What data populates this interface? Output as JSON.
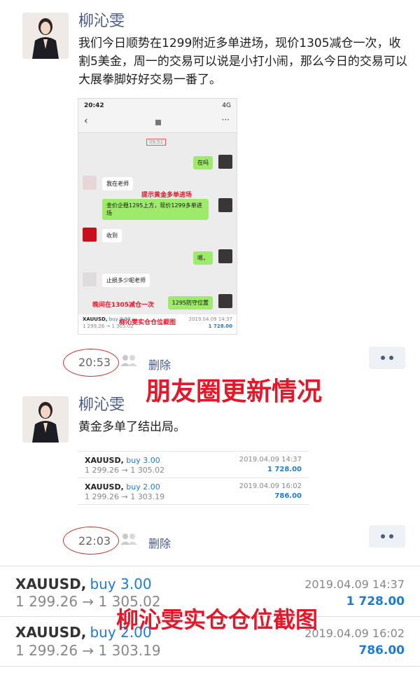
{
  "post1": {
    "author": "柳沁雯",
    "text": "我们今日顺势在1299附近多单进场，现价1305减仓一次，收割5美金，周一的交易可以说是小打小闹，那么今日的交易可以大展拳脚好好交易一番了。",
    "time": "20:53",
    "delete_label": "删除"
  },
  "chat_screenshot": {
    "status_time": "20:42",
    "network": "4G",
    "msg_time": "09:51",
    "messages": [
      {
        "side": "right",
        "text": "在吗"
      },
      {
        "side": "left",
        "text": "我在老师"
      },
      {
        "side": "right",
        "text": "金价企稳1295上方，现价1299多单进场"
      },
      {
        "side": "left",
        "text": "收到"
      },
      {
        "side": "right",
        "text": "嗯，"
      },
      {
        "side": "left",
        "text": "止损多少呢老师"
      },
      {
        "side": "right",
        "text": "1295防守位置"
      }
    ],
    "annotation_top": "提示黄金多单进场",
    "annotation_bottom": "晚间在1305减仓一次",
    "trade": {
      "symbol": "XAUUSD,",
      "side": "buy 3.00",
      "prices": "1 299.26 → 1 305.02",
      "date": "2019.04.09 14:37",
      "profit": "1 728.00"
    },
    "caption": "柳沁雯实仓仓位截图"
  },
  "overlay_update": "朋友圈更新情况",
  "post2": {
    "author": "柳沁雯",
    "text": "黄金多单了结出局。",
    "time": "22:03",
    "delete_label": "删除",
    "trades": [
      {
        "symbol": "XAUUSD,",
        "side": "buy 3.00",
        "prices": "1 299.26 → 1 305.02",
        "date": "2019.04.09 14:37",
        "profit": "1 728.00"
      },
      {
        "symbol": "XAUUSD,",
        "side": "buy 2.00",
        "prices": "1 299.26 → 1 303.19",
        "date": "2019.04.09 16:02",
        "profit": "786.00"
      }
    ]
  },
  "bottom_trades": [
    {
      "symbol": "XAUUSD,",
      "side": "buy 3.00",
      "prices": "1 299.26 → 1 305.02",
      "date": "2019.04.09 14:37",
      "profit": "1 728.00"
    },
    {
      "symbol": "XAUUSD,",
      "side": "buy 2.00",
      "prices": "1 299.26 → 1 303.19",
      "date": "2019.04.09 16:02",
      "profit": "786.00"
    }
  ],
  "overlay_caption": "柳沁雯实仓仓位截图",
  "colors": {
    "name_blue": "#4a5a84",
    "profit_blue": "#1e7bd0",
    "annotation_red": "#e3182b",
    "chat_green": "#9eea6a"
  },
  "icons": [
    "people-icon",
    "more-icon",
    "back-icon"
  ]
}
